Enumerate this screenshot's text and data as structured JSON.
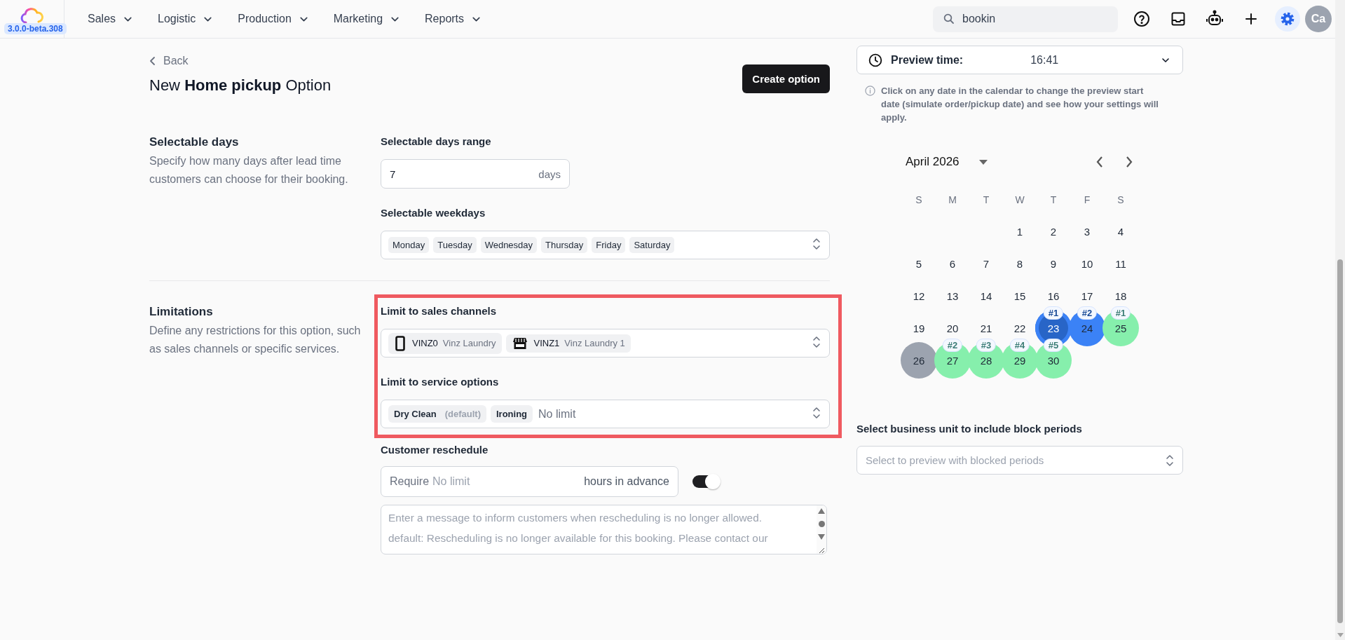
{
  "app": {
    "version": "3.0.0-beta.308"
  },
  "nav": [
    {
      "label": "Sales"
    },
    {
      "label": "Logistic"
    },
    {
      "label": "Production"
    },
    {
      "label": "Marketing"
    },
    {
      "label": "Reports"
    }
  ],
  "search": {
    "value": "bookin"
  },
  "toolbar": [
    {
      "kind": "help",
      "selected": false
    },
    {
      "kind": "inbox",
      "selected": false
    },
    {
      "kind": "robot",
      "selected": false
    },
    {
      "kind": "add",
      "selected": false
    },
    {
      "kind": "settings",
      "selected": true
    }
  ],
  "user": {
    "initials": "Ca"
  },
  "header": {
    "back": "Back",
    "title": "New **Home pickup** Option",
    "action": "Create option"
  },
  "sections": [
    {
      "title": "Selectable days",
      "description": "Specify how many days after lead time customers can choose for their booking.",
      "fields": [
        {
          "kind": "number",
          "label": "Selectable days range",
          "highlighted": false,
          "value": "7",
          "suffix": "days"
        },
        {
          "kind": "tags",
          "label": "Selectable weekdays",
          "highlighted": false,
          "tags": [
            {
              "label": "Monday"
            },
            {
              "label": "Tuesday"
            },
            {
              "label": "Wednesday"
            },
            {
              "label": "Thursday"
            },
            {
              "label": "Friday"
            },
            {
              "label": "Saturday"
            }
          ]
        }
      ]
    },
    {
      "title": "Limitations",
      "description": "Define any restrictions for this option, such as sales channels or specific services.",
      "fields": [
        {
          "kind": "channels",
          "label": "Limit to sales channels",
          "highlighted": true,
          "channels": [
            {
              "kind": "phone",
              "code": "VINZ0",
              "name": "Vinz Laundry"
            },
            {
              "kind": "store",
              "code": "VINZ1",
              "name": "Vinz Laundry 1"
            }
          ]
        },
        {
          "kind": "services",
          "label": "Limit to service options",
          "highlighted": true,
          "tags": [
            {
              "label": "Dry Clean",
              "note": "(default)"
            },
            {
              "label": "Ironing"
            }
          ],
          "placeholder": "No limit"
        },
        {
          "kind": "reschedule",
          "label": "Customer reschedule",
          "highlighted": false,
          "prefix": "Require",
          "placeholder": "No limit",
          "suffix": "hours in advance",
          "toggle": {
            "on": true
          },
          "message_placeholder": "Enter a message to inform customers when rescheduling is no longer allowed.\ndefault: Rescheduling is no longer available for this booking. Please contact our"
        }
      ]
    }
  ],
  "preview": {
    "label": "Preview time:",
    "value": "16:41",
    "info": "Click on any date in the calendar to change the preview start date (simulate order/pickup date) and see how your settings will apply.",
    "calendar": {
      "month": "April 2026",
      "weekdays": [
        "S",
        "M",
        "T",
        "W",
        "T",
        "F",
        "S"
      ],
      "weeks": [
        [
          {
            "day": "1",
            "selected": false
          },
          {
            "day": "2",
            "selected": false
          },
          {
            "day": "3",
            "selected": false
          },
          {
            "day": "4",
            "selected": false
          }
        ],
        [
          {
            "day": "5",
            "selected": false
          },
          {
            "day": "6",
            "selected": false
          },
          {
            "day": "7",
            "selected": false
          },
          {
            "day": "8",
            "selected": false
          },
          {
            "day": "9",
            "selected": false
          },
          {
            "day": "10",
            "selected": false
          },
          {
            "day": "11",
            "selected": false
          }
        ],
        [
          {
            "day": "12",
            "selected": false
          },
          {
            "day": "13",
            "selected": false
          },
          {
            "day": "14",
            "selected": false
          },
          {
            "day": "15",
            "selected": false
          },
          {
            "day": "16",
            "selected": false
          },
          {
            "day": "17",
            "selected": false
          },
          {
            "day": "18",
            "selected": false
          }
        ],
        [
          {
            "day": "19",
            "selected": false
          },
          {
            "day": "20",
            "selected": false
          },
          {
            "day": "21",
            "selected": false
          },
          {
            "day": "22",
            "selected": false
          },
          {
            "day": "23",
            "selected": true,
            "color": "#3b82f6",
            "badge": "#1"
          },
          {
            "day": "24",
            "selected": false,
            "color": "#3b82f6",
            "badge": "#2"
          },
          {
            "day": "25",
            "selected": false,
            "color": "#86efac",
            "badge": "#1"
          }
        ],
        [
          {
            "day": "26",
            "selected": false,
            "color": "#9ca3af"
          },
          {
            "day": "27",
            "selected": false,
            "color": "#86efac",
            "badge": "#2"
          },
          {
            "day": "28",
            "selected": false,
            "color": "#86efac",
            "badge": "#3"
          },
          {
            "day": "29",
            "selected": false,
            "color": "#86efac",
            "badge": "#4"
          },
          {
            "day": "30",
            "selected": false,
            "color": "#86efac",
            "badge": "#5"
          }
        ]
      ]
    },
    "business_unit": {
      "label": "Select business unit to include block periods",
      "placeholder": "Select to preview with blocked periods"
    }
  }
}
